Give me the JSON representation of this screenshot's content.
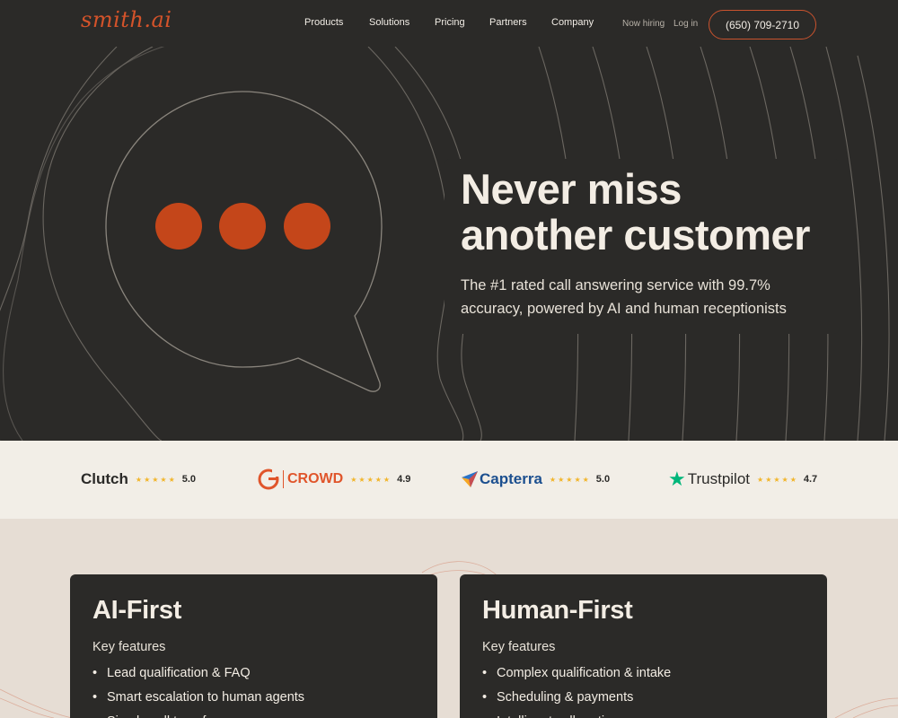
{
  "nav": {
    "logo": "smith.ai",
    "links": [
      "Products",
      "Solutions",
      "Pricing",
      "Partners",
      "Company"
    ],
    "hiring": "Now hiring",
    "login": "Log in",
    "phone": "(650) 709-2710"
  },
  "hero": {
    "title_line1": "Never miss",
    "title_line2": "another customer",
    "subtitle": "The #1 rated call answering service with 99.7% accuracy, powered by AI and human receptionists"
  },
  "reviews": [
    {
      "brand": "Clutch",
      "score": "5.0",
      "stars": 5
    },
    {
      "brand": "CROWD",
      "score": "4.9",
      "stars": 5
    },
    {
      "brand": "Capterra",
      "score": "5.0",
      "stars": 5
    },
    {
      "brand": "Trustpilot",
      "score": "4.7",
      "stars": 5
    }
  ],
  "cards": {
    "ai": {
      "title": "AI-First",
      "key": "Key features",
      "items": [
        "Lead qualification & FAQ",
        "Smart escalation to human agents",
        "Simple call transfers"
      ]
    },
    "human": {
      "title": "Human-First",
      "key": "Key features",
      "items": [
        "Complex qualification & intake",
        "Scheduling & payments",
        "Intelligent call routing"
      ]
    }
  },
  "colors": {
    "accent": "#c9532e",
    "dark": "#2b2a28",
    "cream": "#f2eee7",
    "star": "#f2b52a"
  }
}
